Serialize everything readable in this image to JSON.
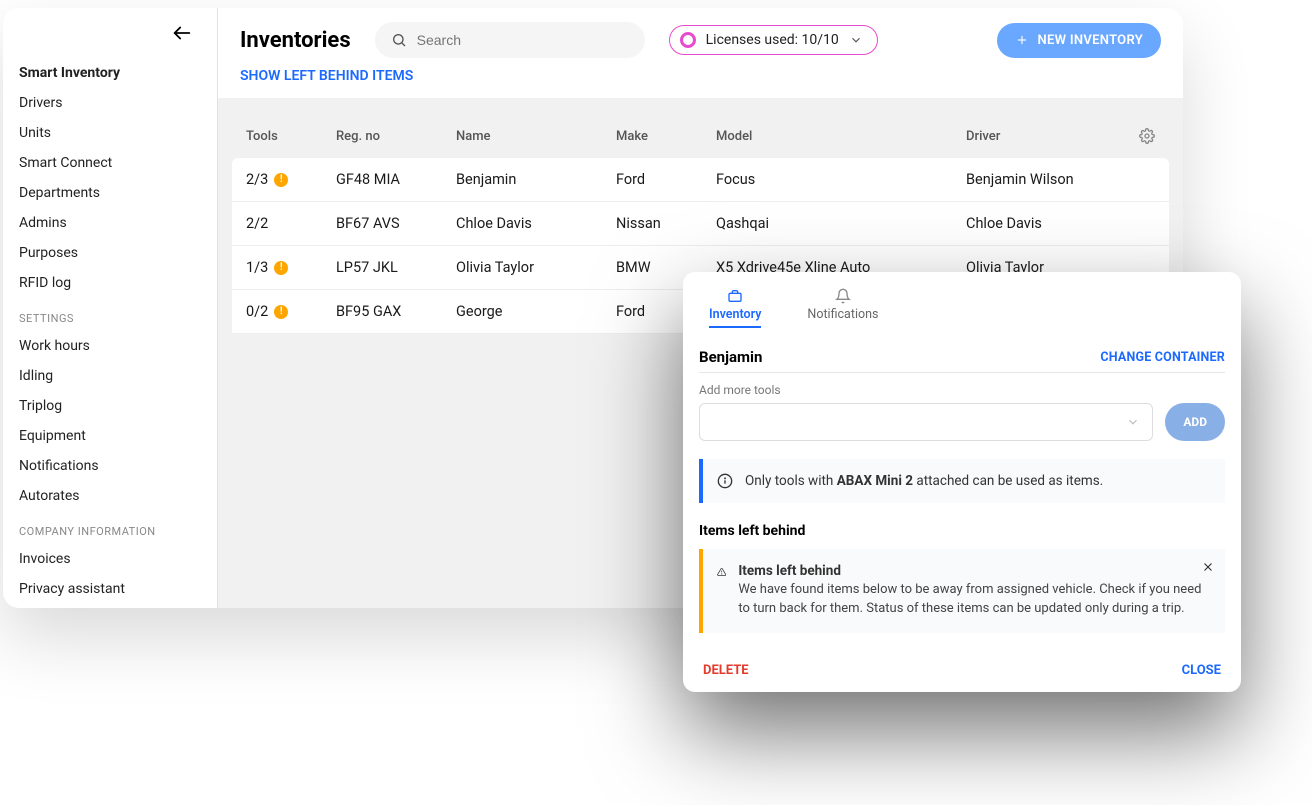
{
  "sidebar": {
    "nav": [
      "Smart Inventory",
      "Drivers",
      "Units",
      "Smart Connect",
      "Departments",
      "Admins",
      "Purposes",
      "RFID log"
    ],
    "settings_heading": "SETTINGS",
    "settings": [
      "Work hours",
      "Idling",
      "Triplog",
      "Equipment",
      "Notifications",
      "Autorates"
    ],
    "company_heading": "COMPANY INFORMATION",
    "company": [
      "Invoices",
      "Privacy assistant"
    ]
  },
  "header": {
    "title": "Inventories",
    "search_placeholder": "Search",
    "licenses_text": "Licenses used: 10/10",
    "new_button": "NEW INVENTORY",
    "show_link": "SHOW LEFT BEHIND ITEMS"
  },
  "table": {
    "columns": [
      "Tools",
      "Reg. no",
      "Name",
      "Make",
      "Model",
      "Driver"
    ],
    "rows": [
      {
        "tools": "2/3",
        "warn": true,
        "reg": "GF48 MIA",
        "name": "Benjamin",
        "make": "Ford",
        "model": "Focus",
        "driver": "Benjamin Wilson"
      },
      {
        "tools": "2/2",
        "warn": false,
        "reg": "BF67 AVS",
        "name": "Chloe Davis",
        "make": "Nissan",
        "model": "Qashqai",
        "driver": "Chloe Davis"
      },
      {
        "tools": "1/3",
        "warn": true,
        "reg": "LP57 JKL",
        "name": "Olivia Taylor",
        "make": "BMW",
        "model": "X5 Xdrive45e Xline Auto",
        "driver": "Olivia Taylor"
      },
      {
        "tools": "0/2",
        "warn": true,
        "reg": "BF95 GAX",
        "name": "George",
        "make": "Ford",
        "model": "",
        "driver": ""
      }
    ]
  },
  "detail": {
    "tabs": {
      "inventory": "Inventory",
      "notifications": "Notifications"
    },
    "container_name": "Benjamin",
    "change_container": "CHANGE CONTAINER",
    "add_label": "Add more tools",
    "add_button": "ADD",
    "info_prefix": "Only tools with ",
    "info_bold": "ABAX Mini 2",
    "info_suffix": " attached can be used as items.",
    "section_title": "Items left behind",
    "warn_title": "Items left behind",
    "warn_body": "We have found items below to be away from assigned vehicle. Check if you need to turn back for them. Status of these items can be updated only during a trip.",
    "delete": "DELETE",
    "close": "CLOSE"
  }
}
